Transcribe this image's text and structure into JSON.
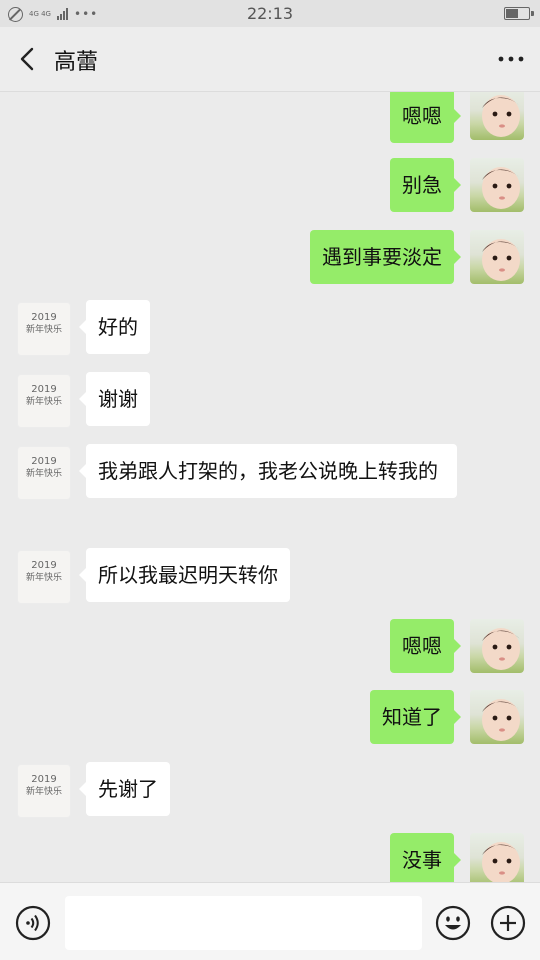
{
  "status_bar": {
    "network_label": "4G 4G",
    "dots": "•••",
    "time": "22:13"
  },
  "header": {
    "title": "高蕾"
  },
  "messages": [
    {
      "side": "me",
      "text": "嗯嗯"
    },
    {
      "side": "me",
      "text": "别急"
    },
    {
      "side": "me",
      "text": "遇到事要淡定"
    },
    {
      "side": "friend",
      "text": "好的"
    },
    {
      "side": "friend",
      "text": "谢谢"
    },
    {
      "side": "friend",
      "text": "我弟跟人打架的，我老公说晚上转我的"
    },
    {
      "side": "friend",
      "text": "所以我最迟明天转你"
    },
    {
      "side": "me",
      "text": "嗯嗯"
    },
    {
      "side": "me",
      "text": "知道了"
    },
    {
      "side": "friend",
      "text": "先谢了"
    },
    {
      "side": "me",
      "text": "没事"
    }
  ],
  "friend_avatar": {
    "line1": "2019",
    "line2": "新年快乐"
  },
  "input": {
    "value": "",
    "placeholder": ""
  },
  "colors": {
    "my_bubble": "#95ec69",
    "friend_bubble": "#ffffff",
    "background": "#ebebeb"
  }
}
